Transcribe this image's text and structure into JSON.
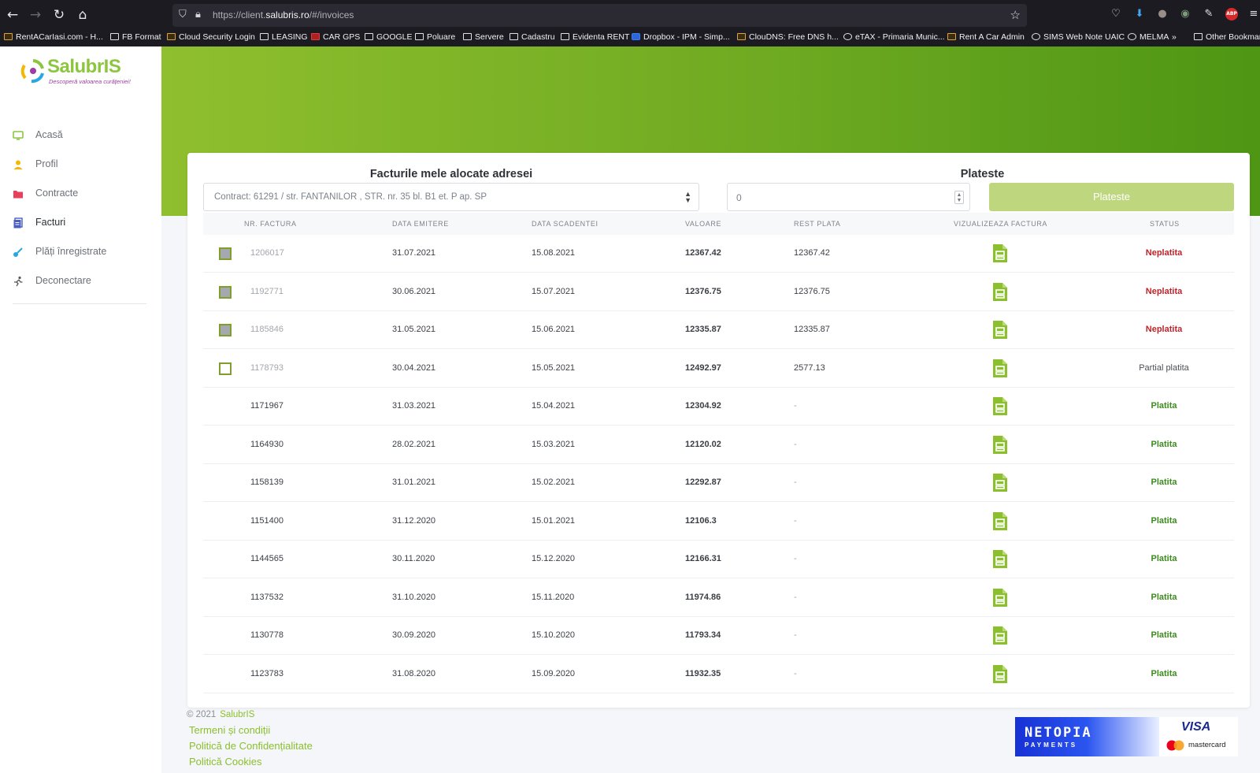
{
  "browser": {
    "url_prefix": "https://client.",
    "url_host": "salubris.ro",
    "url_path": "/#/invoices",
    "bookmarks": [
      {
        "label": "RentACarIasi.com - H...",
        "icon": "favicon"
      },
      {
        "label": "FB Format",
        "icon": "folder"
      },
      {
        "label": "Cloud Security Login",
        "icon": "favicon"
      },
      {
        "label": "LEASING",
        "icon": "folder"
      },
      {
        "label": "CAR GPS",
        "icon": "favicon"
      },
      {
        "label": "GOOGLE",
        "icon": "folder"
      },
      {
        "label": "Poluare",
        "icon": "folder"
      },
      {
        "label": "Servere",
        "icon": "folder"
      },
      {
        "label": "Cadastru",
        "icon": "folder"
      },
      {
        "label": "Evidenta RENT",
        "icon": "folder"
      },
      {
        "label": "Dropbox - IPM - Simp...",
        "icon": "favicon"
      },
      {
        "label": "ClouDNS: Free DNS h...",
        "icon": "favicon"
      },
      {
        "label": "eTAX - Primaria Munic...",
        "icon": "globe"
      },
      {
        "label": "Rent A Car Admin",
        "icon": "favicon"
      },
      {
        "label": "SIMS Web Note UAIC",
        "icon": "globe"
      },
      {
        "label": "MELMA",
        "icon": "globe"
      },
      {
        "label": "»",
        "icon": "none"
      },
      {
        "label": "Other Bookmar",
        "icon": "folder"
      }
    ],
    "adblock_label": "ABP"
  },
  "sidebar": {
    "logo_name": "SalubrIS",
    "logo_tagline": "Descoperă valoarea curățeniei!",
    "items": [
      {
        "label": "Acasă",
        "icon": "monitor-icon",
        "color": "#8cc63f"
      },
      {
        "label": "Profil",
        "icon": "user-icon",
        "color": "#f5b800"
      },
      {
        "label": "Contracte",
        "icon": "folder-icon",
        "color": "#e8405a"
      },
      {
        "label": "Facturi",
        "icon": "invoice-icon",
        "color": "#4a5fc1"
      },
      {
        "label": "Plăți înregistrate",
        "icon": "payment-icon",
        "color": "#29a8e0"
      },
      {
        "label": "Deconectare",
        "icon": "logout-icon",
        "color": "#555555"
      }
    ],
    "active": "Facturi"
  },
  "main": {
    "invoices_title": "Facturile mele alocate adresei",
    "pay_title": "Plateste",
    "contract_select": "Contract: 61291 / str. FANTANILOR , STR. nr. 35 bl. B1 et. P ap. SP",
    "amount_value": "0",
    "pay_button": "Plateste"
  },
  "table": {
    "headers": [
      "NR. FACTURA",
      "DATA EMITERE",
      "DATA SCADENTEI",
      "VALOARE",
      "REST PLATA",
      "VIZUALIZEAZA FACTURA",
      "STATUS"
    ],
    "rows": [
      {
        "nr": "1206017",
        "emitere": "31.07.2021",
        "scadenta": "15.08.2021",
        "valoare": "12367.42",
        "rest": "12367.42",
        "status": "Neplatita",
        "checkbox": "checked"
      },
      {
        "nr": "1192771",
        "emitere": "30.06.2021",
        "scadenta": "15.07.2021",
        "valoare": "12376.75",
        "rest": "12376.75",
        "status": "Neplatita",
        "checkbox": "checked"
      },
      {
        "nr": "1185846",
        "emitere": "31.05.2021",
        "scadenta": "15.06.2021",
        "valoare": "12335.87",
        "rest": "12335.87",
        "status": "Neplatita",
        "checkbox": "checked"
      },
      {
        "nr": "1178793",
        "emitere": "30.04.2021",
        "scadenta": "15.05.2021",
        "valoare": "12492.97",
        "rest": "2577.13",
        "status": "Partial platita",
        "checkbox": "unchecked"
      },
      {
        "nr": "1171967",
        "emitere": "31.03.2021",
        "scadenta": "15.04.2021",
        "valoare": "12304.92",
        "rest": "-",
        "status": "Platita",
        "checkbox": "none"
      },
      {
        "nr": "1164930",
        "emitere": "28.02.2021",
        "scadenta": "15.03.2021",
        "valoare": "12120.02",
        "rest": "-",
        "status": "Platita",
        "checkbox": "none"
      },
      {
        "nr": "1158139",
        "emitere": "31.01.2021",
        "scadenta": "15.02.2021",
        "valoare": "12292.87",
        "rest": "-",
        "status": "Platita",
        "checkbox": "none"
      },
      {
        "nr": "1151400",
        "emitere": "31.12.2020",
        "scadenta": "15.01.2021",
        "valoare": "12106.3",
        "rest": "-",
        "status": "Platita",
        "checkbox": "none"
      },
      {
        "nr": "1144565",
        "emitere": "30.11.2020",
        "scadenta": "15.12.2020",
        "valoare": "12166.31",
        "rest": "-",
        "status": "Platita",
        "checkbox": "none"
      },
      {
        "nr": "1137532",
        "emitere": "31.10.2020",
        "scadenta": "15.11.2020",
        "valoare": "11974.86",
        "rest": "-",
        "status": "Platita",
        "checkbox": "none"
      },
      {
        "nr": "1130778",
        "emitere": "30.09.2020",
        "scadenta": "15.10.2020",
        "valoare": "11793.34",
        "rest": "-",
        "status": "Platita",
        "checkbox": "none"
      },
      {
        "nr": "1123783",
        "emitere": "31.08.2020",
        "scadenta": "15.09.2020",
        "valoare": "11932.35",
        "rest": "-",
        "status": "Platita",
        "checkbox": "none"
      }
    ]
  },
  "footer": {
    "copyright": "© 2021",
    "brand": "SalubrIS",
    "links": [
      "Termeni și condiții",
      "Politică de Confidențialitate",
      "Politică Cookies"
    ],
    "netopia_name": "NETOPIA",
    "netopia_sub": "PAYMENTS",
    "visa": "VISA",
    "mastercard": "mastercard"
  },
  "colors": {
    "accent": "#8cc63f",
    "neplatita": "#c0222a",
    "platita": "#3b8b1e",
    "hero_start": "#8fbf2e",
    "hero_end": "#4e9614"
  }
}
